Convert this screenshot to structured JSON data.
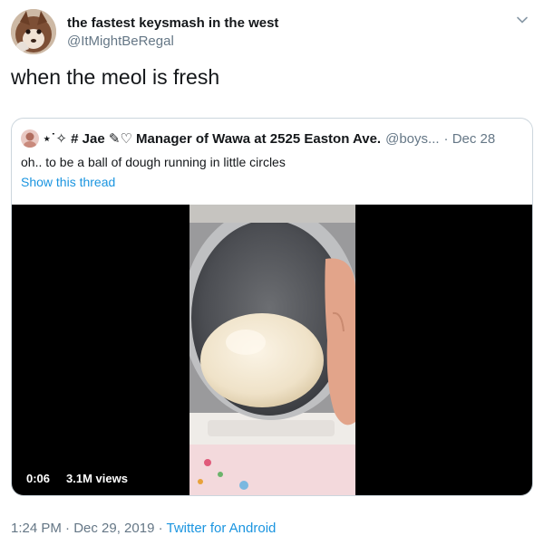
{
  "tweet": {
    "author": {
      "display_name": "the fastest keysmash in the west",
      "handle": "@ItMightBeRegal",
      "avatar_icon": "fox-avatar-icon"
    },
    "menu_icon": "chevron-down-icon",
    "text": "when the meol is fresh",
    "timestamp": "1:24 PM · Dec 29, 2019 · ",
    "source": "Twitter for Android"
  },
  "quoted": {
    "display_name": "⋆˙✧ # Jae ✎♡ Manager of Wawa at 2525 Easton Ave.",
    "handle": "@boys...",
    "date": "· Dec 28",
    "text": "oh.. to be a ball of dough running in little circles",
    "show_thread": "Show this thread",
    "video": {
      "duration": "0:06",
      "views": "3.1M views"
    }
  },
  "colors": {
    "text": "#14171a",
    "secondary": "#657786",
    "link": "#1b95e0",
    "border": "#ccd6dd",
    "video_bg": "#000000"
  }
}
